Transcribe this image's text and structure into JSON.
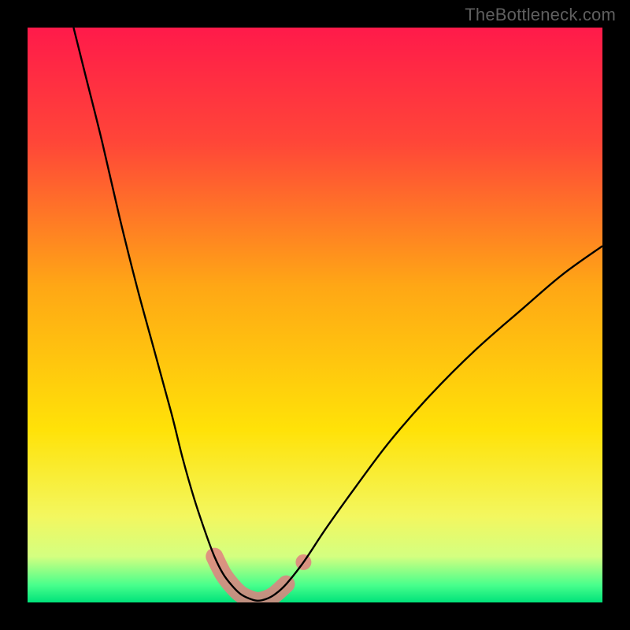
{
  "watermark": "TheBottleneck.com",
  "chart_data": {
    "type": "line",
    "title": "",
    "xlabel": "",
    "ylabel": "",
    "xlim": [
      0,
      100
    ],
    "ylim": [
      0,
      100
    ],
    "gradient_stops": [
      {
        "offset": 0,
        "color": "#ff1a4a"
      },
      {
        "offset": 20,
        "color": "#ff4638"
      },
      {
        "offset": 45,
        "color": "#ffa715"
      },
      {
        "offset": 70,
        "color": "#ffe208"
      },
      {
        "offset": 85,
        "color": "#f3f75f"
      },
      {
        "offset": 92,
        "color": "#d4ff80"
      },
      {
        "offset": 97,
        "color": "#48ff8c"
      },
      {
        "offset": 100,
        "color": "#00e27a"
      }
    ],
    "series": [
      {
        "name": "bottleneck-curve",
        "color": "#000000",
        "width": 2.4,
        "points": [
          {
            "x": 8,
            "y": 100
          },
          {
            "x": 10,
            "y": 92
          },
          {
            "x": 13,
            "y": 80
          },
          {
            "x": 16,
            "y": 67
          },
          {
            "x": 19,
            "y": 55
          },
          {
            "x": 22,
            "y": 44
          },
          {
            "x": 25,
            "y": 33
          },
          {
            "x": 27,
            "y": 25
          },
          {
            "x": 29,
            "y": 18
          },
          {
            "x": 31,
            "y": 12
          },
          {
            "x": 32.5,
            "y": 8
          },
          {
            "x": 34,
            "y": 5
          },
          {
            "x": 35.5,
            "y": 3
          },
          {
            "x": 37,
            "y": 1.5
          },
          {
            "x": 38.5,
            "y": 0.7
          },
          {
            "x": 40,
            "y": 0.3
          },
          {
            "x": 41.5,
            "y": 0.6
          },
          {
            "x": 43,
            "y": 1.4
          },
          {
            "x": 45,
            "y": 3.2
          },
          {
            "x": 48,
            "y": 7
          },
          {
            "x": 52,
            "y": 13
          },
          {
            "x": 57,
            "y": 20
          },
          {
            "x": 63,
            "y": 28
          },
          {
            "x": 70,
            "y": 36
          },
          {
            "x": 78,
            "y": 44
          },
          {
            "x": 86,
            "y": 51
          },
          {
            "x": 93,
            "y": 57
          },
          {
            "x": 100,
            "y": 62
          }
        ]
      }
    ],
    "markers": [
      {
        "name": "highlight-band",
        "color": "#e08080",
        "opacity": 0.85,
        "points": [
          {
            "x": 32.5,
            "y": 8
          },
          {
            "x": 34,
            "y": 5
          },
          {
            "x": 35.5,
            "y": 3
          },
          {
            "x": 37,
            "y": 1.5
          },
          {
            "x": 38.5,
            "y": 0.7
          },
          {
            "x": 40,
            "y": 0.3
          },
          {
            "x": 41.5,
            "y": 0.6
          },
          {
            "x": 43,
            "y": 1.4
          },
          {
            "x": 45,
            "y": 3.2
          }
        ],
        "width": 22
      },
      {
        "name": "marker-dot",
        "color": "#e08080",
        "opacity": 0.85,
        "x": 48,
        "y": 7,
        "r": 10
      }
    ]
  }
}
